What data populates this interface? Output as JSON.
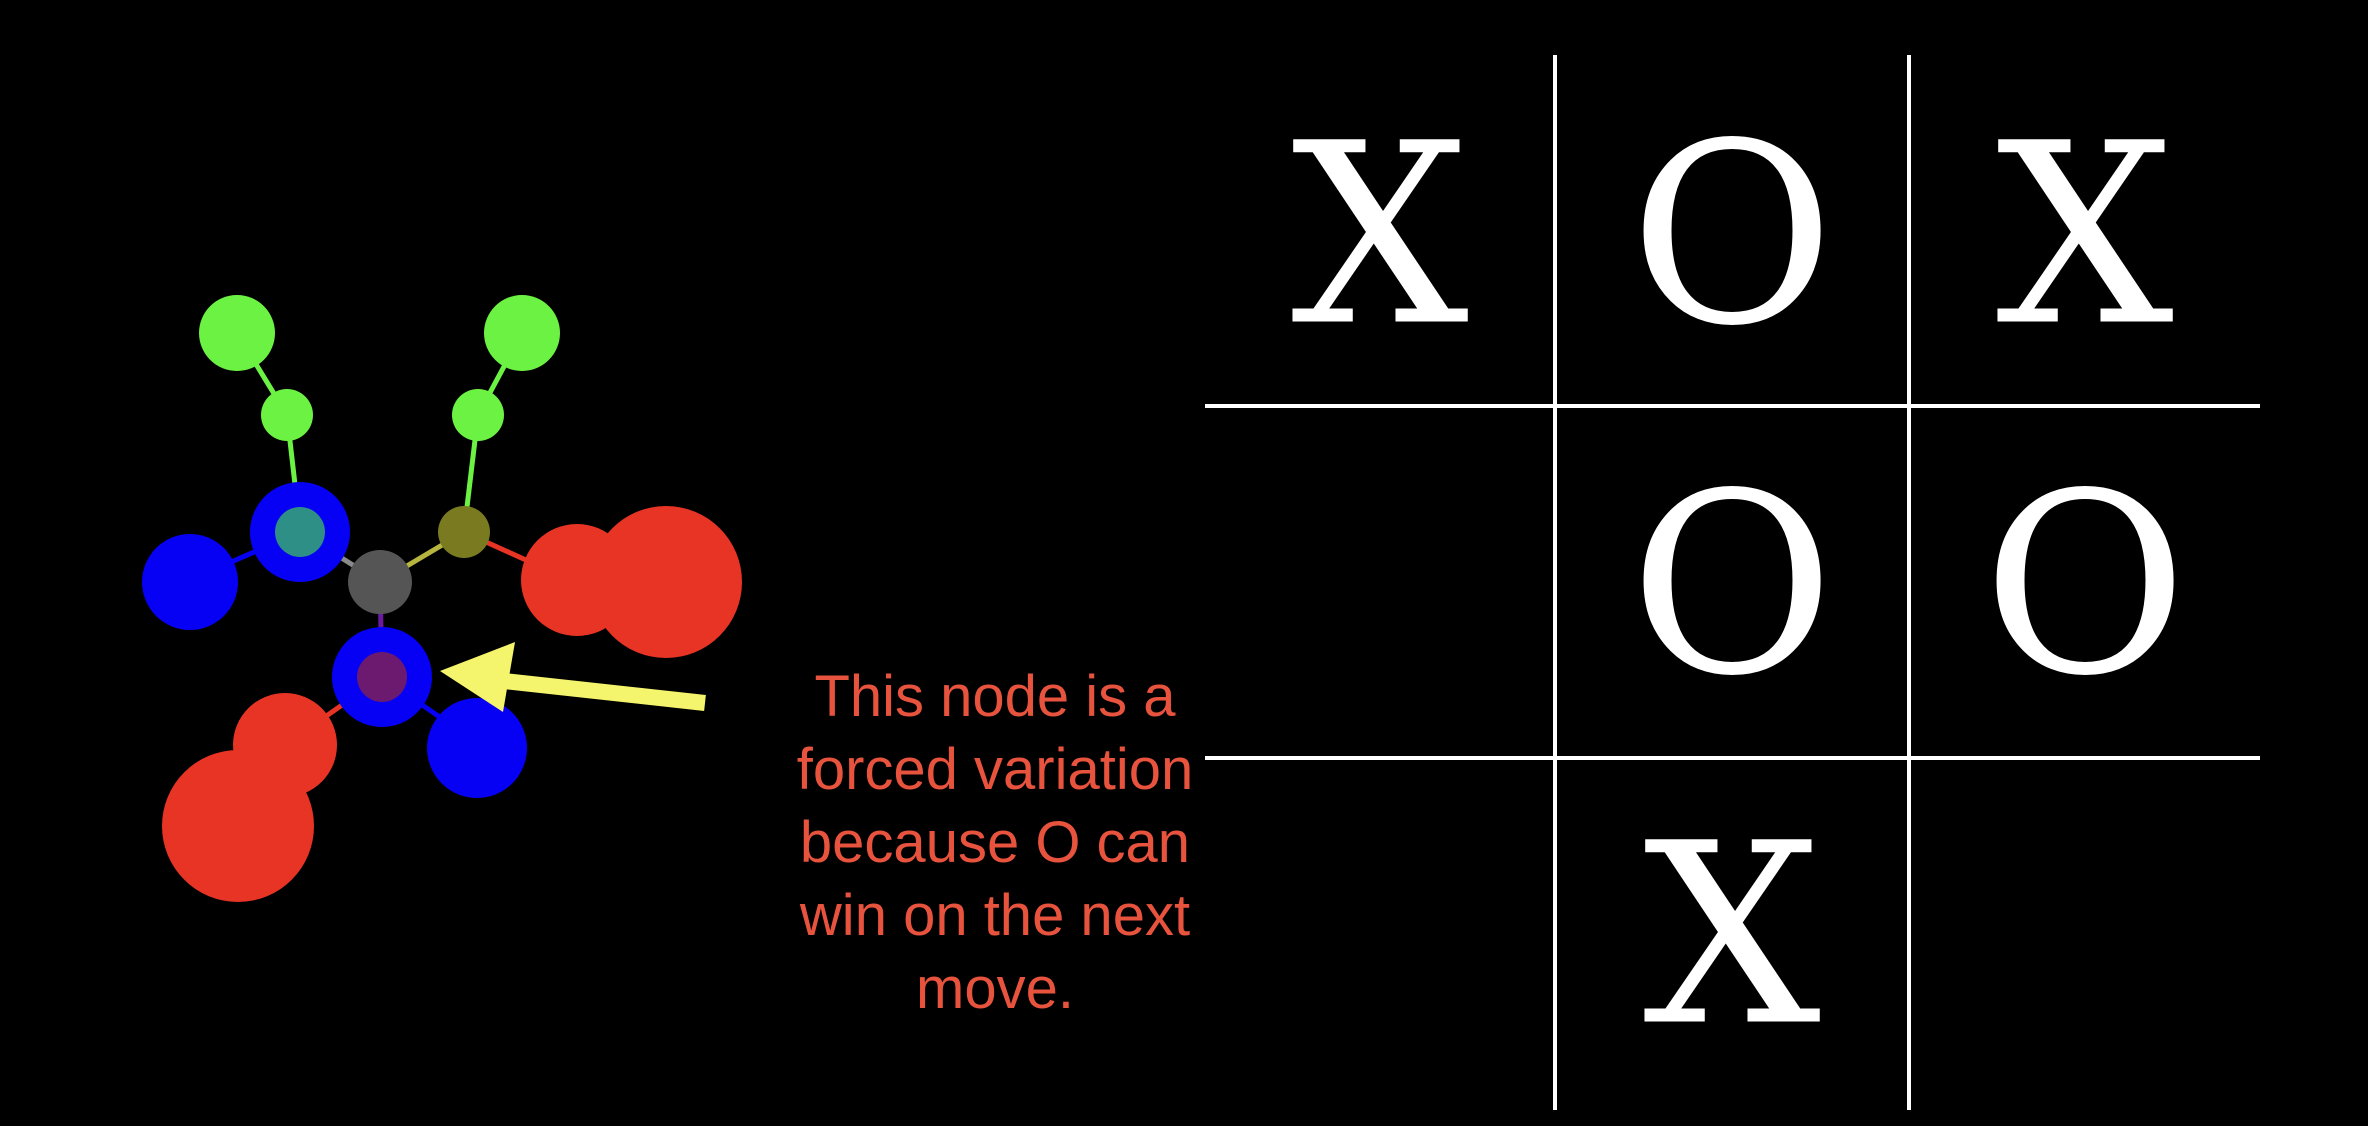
{
  "callout": {
    "lines": [
      "This node is a",
      "forced variation",
      "because O can",
      "win on the next",
      "move."
    ],
    "color": "#e8533e"
  },
  "arrow_color": "#f4f56c",
  "board": {
    "cells": [
      [
        "X",
        "O",
        "X"
      ],
      [
        "",
        "O",
        "O"
      ],
      [
        "",
        "X",
        ""
      ]
    ]
  },
  "tree": {
    "node_colors": {
      "green": "#6cf243",
      "blue": "#0600f5",
      "red": "#e83425",
      "gray": "#555555",
      "olive": "#7a7a20",
      "teal": "#2e8f86",
      "purple": "#6b1a6f"
    }
  }
}
